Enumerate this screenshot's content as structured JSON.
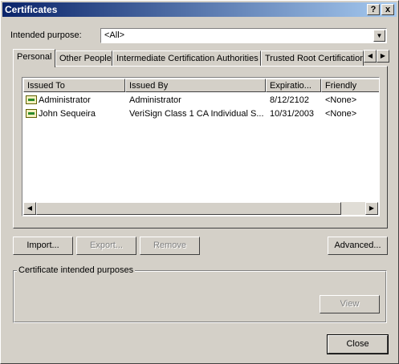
{
  "window": {
    "title": "Certificates",
    "help_label": "?",
    "close_label": "x"
  },
  "purpose": {
    "label": "Intended purpose:",
    "value": "<All>"
  },
  "tabs": [
    {
      "label": "Personal"
    },
    {
      "label": "Other People"
    },
    {
      "label": "Intermediate Certification Authorities"
    },
    {
      "label": "Trusted Root Certification"
    }
  ],
  "list": {
    "columns": [
      "Issued To",
      "Issued By",
      "Expiratio...",
      "Friendly Name"
    ],
    "rows": [
      {
        "issued_to": "Administrator",
        "issued_by": "Administrator",
        "expiration": "8/12/2102",
        "friendly": "<None>"
      },
      {
        "issued_to": "John Sequeira",
        "issued_by": "VeriSign Class 1 CA Individual S...",
        "expiration": "10/31/2003",
        "friendly": "<None>"
      }
    ]
  },
  "buttons": {
    "import": "Import...",
    "export": "Export...",
    "remove": "Remove",
    "advanced": "Advanced...",
    "view": "View",
    "close": "Close"
  },
  "group": {
    "label": "Certificate intended purposes"
  },
  "icons": {
    "scroll_left": "triangle-left",
    "scroll_right": "triangle-right",
    "dropdown": "triangle-down",
    "cert": "certificate-icon"
  }
}
